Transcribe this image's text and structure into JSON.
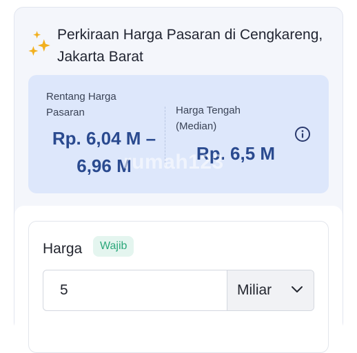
{
  "header": {
    "title": "Perkiraan Harga Pasaran di Cengkareng, Jakarta Barat",
    "icon": "sparkles-icon",
    "icon_color": "#f2b01e"
  },
  "price_range": {
    "range_label": "Rentang Harga Pasaran",
    "range_value": "Rp. 6,04 M – 6,96 M",
    "median_label": "Harga Tengah (Median)",
    "median_value": "Rp. 6,5 M",
    "watermark": "rumah123",
    "info_icon": "info-icon",
    "value_color": "#2a4a8f",
    "box_color": "#dde7fb"
  },
  "form": {
    "price_label": "Harga",
    "required_badge": "Wajib",
    "price_value": "5",
    "unit_selected": "Miliar",
    "badge_color": "#2ba77a"
  }
}
